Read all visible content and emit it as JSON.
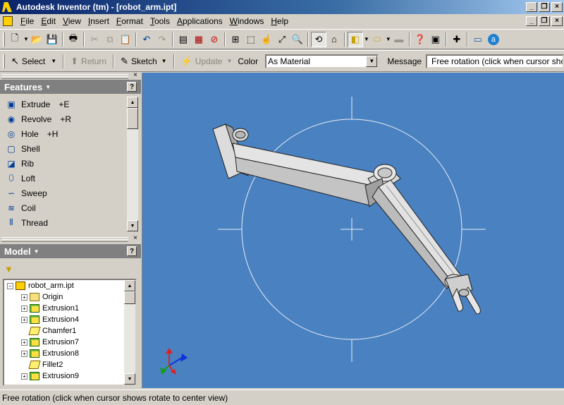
{
  "window": {
    "title": "Autodesk Inventor (tm) - [robot_arm.ipt]"
  },
  "menubar": {
    "items": [
      {
        "label": "File",
        "mnemonic": "F",
        "rest": "ile"
      },
      {
        "label": "Edit",
        "mnemonic": "E",
        "rest": "dit"
      },
      {
        "label": "View",
        "mnemonic": "V",
        "rest": "iew"
      },
      {
        "label": "Insert",
        "mnemonic": "I",
        "rest": "nsert"
      },
      {
        "label": "Format",
        "mnemonic": "F",
        "rest": "ormat"
      },
      {
        "label": "Tools",
        "mnemonic": "T",
        "rest": "ools"
      },
      {
        "label": "Applications",
        "mnemonic": "A",
        "rest": "pplications"
      },
      {
        "label": "Windows",
        "mnemonic": "W",
        "rest": "indows"
      },
      {
        "label": "Help",
        "mnemonic": "H",
        "rest": "elp"
      }
    ]
  },
  "standard_toolbar": {
    "buttons": [
      "new-icon",
      "open-icon",
      "save-icon",
      "print-icon",
      "cut-icon",
      "copy-icon",
      "paste-icon",
      "undo-icon",
      "redo-icon",
      "sketch-doc-icon",
      "parameters-icon",
      "no-select-icon",
      "zoom-all-icon",
      "zoom-window-icon",
      "zoom-icon",
      "pan-icon",
      "zoom-selected-icon",
      "rotate-icon",
      "look-at-icon",
      "display-mode-icon",
      "shadow-icon",
      "camera-icon",
      "whats-this-icon",
      "notes-icon",
      "add-icon",
      "web-icon",
      "autodesk-online-icon"
    ]
  },
  "command_bar": {
    "select_label": "Select",
    "return_label": "Return",
    "sketch_label": "Sketch",
    "update_label": "Update",
    "color_label": "Color",
    "color_value": "As Material",
    "message_label": "Message",
    "message_value": "Free rotation (click when cursor shows ro"
  },
  "features_panel": {
    "title": "Features",
    "items": [
      {
        "label": "Extrude",
        "shortcut": "+E",
        "icon": "extrude-icon"
      },
      {
        "label": "Revolve",
        "shortcut": "+R",
        "icon": "revolve-icon"
      },
      {
        "label": "Hole",
        "shortcut": "+H",
        "icon": "hole-icon"
      },
      {
        "label": "Shell",
        "shortcut": "",
        "icon": "shell-icon"
      },
      {
        "label": "Rib",
        "shortcut": "",
        "icon": "rib-icon"
      },
      {
        "label": "Loft",
        "shortcut": "",
        "icon": "loft-icon"
      },
      {
        "label": "Sweep",
        "shortcut": "",
        "icon": "sweep-icon"
      },
      {
        "label": "Coil",
        "shortcut": "",
        "icon": "coil-icon"
      },
      {
        "label": "Thread",
        "shortcut": "",
        "icon": "thread-icon"
      }
    ]
  },
  "model_panel": {
    "title": "Model",
    "tree": [
      {
        "label": "robot_arm.ipt",
        "icon": "part",
        "expander": "−",
        "level": 0
      },
      {
        "label": "Origin",
        "icon": "folder",
        "expander": "+",
        "level": 1
      },
      {
        "label": "Extrusion1",
        "icon": "ext",
        "expander": "+",
        "level": 1
      },
      {
        "label": "Extrusion4",
        "icon": "ext",
        "expander": "+",
        "level": 1
      },
      {
        "label": "Chamfer1",
        "icon": "cham",
        "expander": "",
        "level": 1
      },
      {
        "label": "Extrusion7",
        "icon": "ext",
        "expander": "+",
        "level": 1
      },
      {
        "label": "Extrusion8",
        "icon": "ext",
        "expander": "+",
        "level": 1
      },
      {
        "label": "Fillet2",
        "icon": "cham",
        "expander": "",
        "level": 1
      },
      {
        "label": "Extrusion9",
        "icon": "ext",
        "expander": "+",
        "level": 1
      }
    ]
  },
  "statusbar": {
    "text": "Free rotation (click when cursor shows rotate to center view)"
  },
  "colors": {
    "viewport_bg": "#4a81c0",
    "titlebar": "#0a246a",
    "part_fill": "#d0d0d0"
  }
}
